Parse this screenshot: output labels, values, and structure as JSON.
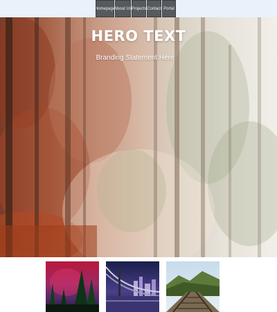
{
  "nav": {
    "items": [
      "Homepage",
      "About Us",
      "Projects",
      "Contact",
      "Portal"
    ]
  },
  "hero": {
    "title": "HERO TEXT",
    "subtitle": "Branding Statement Here",
    "image": "misty-autumn-forest"
  },
  "gallery": {
    "images": [
      "aurora-forest",
      "city-bridge-night",
      "railway-bridge-hills"
    ]
  },
  "colors": {
    "topbar": "#e9f1fa",
    "nav_button": "#555a5e",
    "hero_text": "#ffffff"
  }
}
